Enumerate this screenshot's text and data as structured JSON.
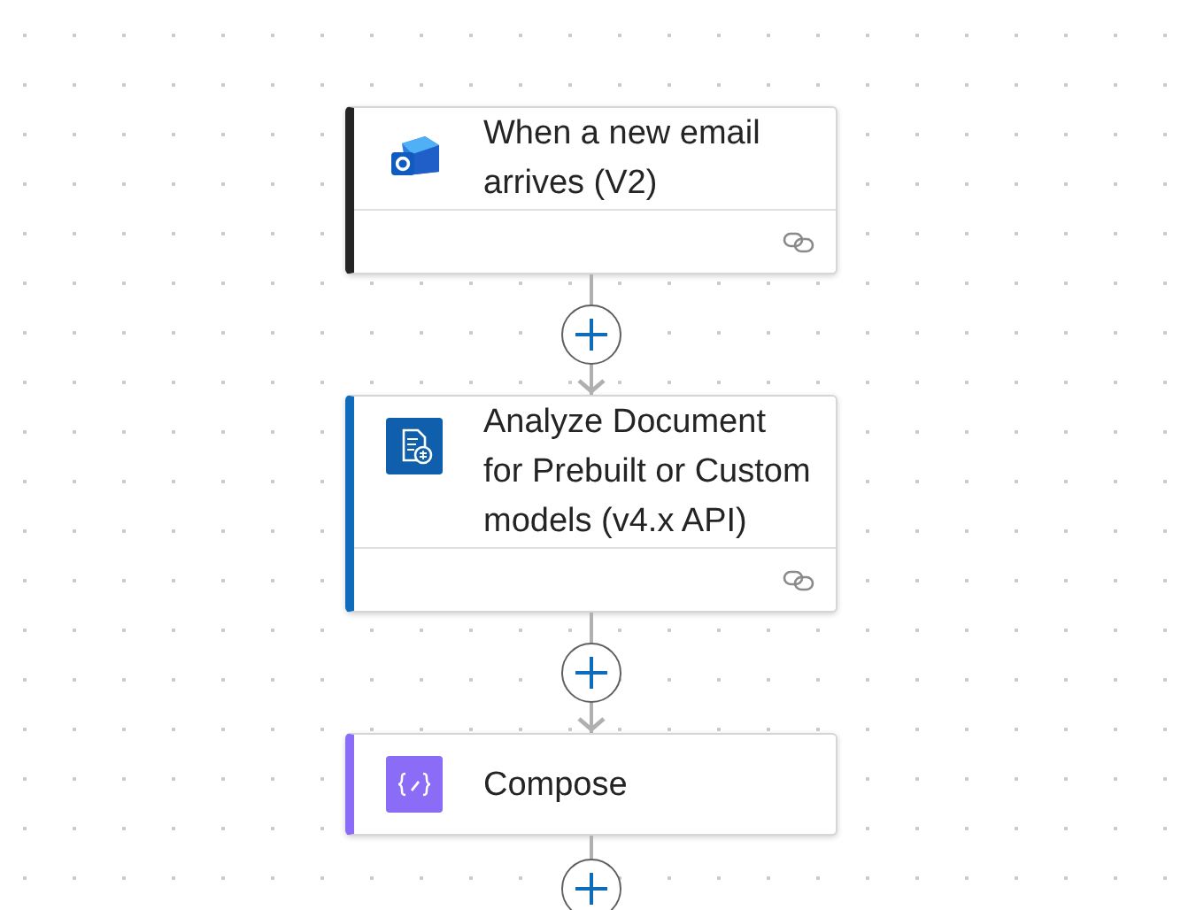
{
  "steps": [
    {
      "title": "When a new email arrives (V2)",
      "kind": "mail",
      "color": "#242424",
      "connection": true
    },
    {
      "title": "Analyze Document for Prebuilt or Custom models (v4.x API)",
      "kind": "document",
      "color": "#0f6cbd",
      "connection": true
    },
    {
      "title": "Compose",
      "kind": "compose",
      "color": "#8b6cf6",
      "connection": false
    }
  ]
}
